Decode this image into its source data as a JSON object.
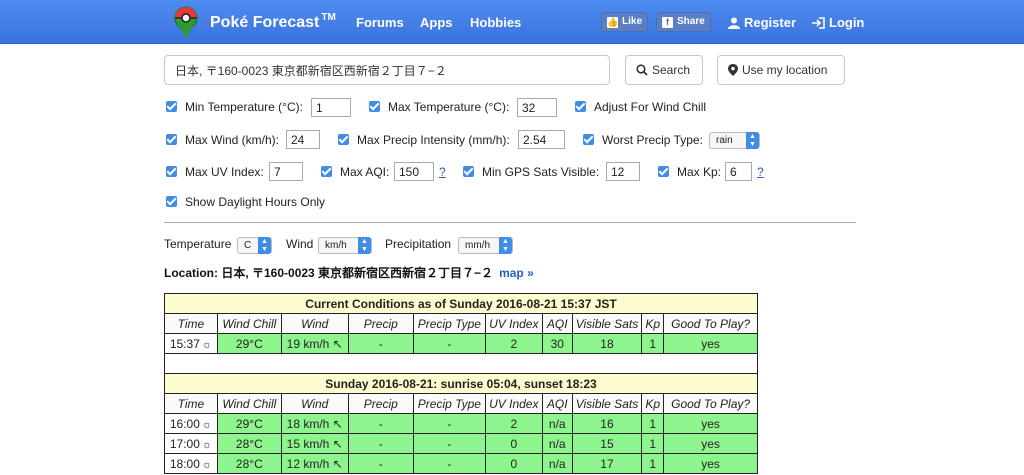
{
  "nav": {
    "brand": "Poké Forecast",
    "trademark": "TM",
    "links": [
      "Forums",
      "Apps",
      "Hobbies"
    ],
    "like": "Like",
    "share": "Share",
    "register": "Register",
    "login": "Login"
  },
  "search": {
    "value": "日本, 〒160-0023 東京都新宿区西新宿２丁目７−２",
    "search_button": "Search",
    "location_button": "Use my location"
  },
  "options": {
    "min_temp_label": "Min Temperature (°C):",
    "min_temp": "1",
    "max_temp_label": "Max Temperature (°C):",
    "max_temp": "32",
    "wind_chill_label": "Adjust For Wind Chill",
    "max_wind_label": "Max Wind (km/h):",
    "max_wind": "24",
    "max_precip_label": "Max Precip Intensity (mm/h):",
    "max_precip": "2.54",
    "worst_precip_label": "Worst Precip Type:",
    "worst_precip": "rain",
    "max_uv_label": "Max UV Index:",
    "max_uv": "7",
    "max_aqi_label": "Max AQI:",
    "max_aqi": "150",
    "min_gps_label": "Min GPS Sats Visible:",
    "min_gps": "12",
    "max_kp_label": "Max Kp:",
    "max_kp": "6",
    "help": "?",
    "daylight_label": "Show Daylight Hours Only"
  },
  "units": {
    "temperature_label": "Temperature",
    "temperature": "C",
    "wind_label": "Wind",
    "wind": "km/h",
    "precip_label": "Precipitation",
    "precip": "mm/h"
  },
  "location": {
    "text": "Location: 日本, 〒160-0023 東京都新宿区西新宿２丁目７−２",
    "map_link": "map »"
  },
  "table": {
    "current_caption": "Current Conditions as of Sunday 2016-08-21 15:37 JST",
    "headers": [
      "Time",
      "Wind Chill",
      "Wind",
      "Precip",
      "Precip Type",
      "UV Index",
      "AQI",
      "Visible Sats",
      "Kp",
      "Good To Play?"
    ],
    "current_row": [
      "15:37",
      "29°C",
      "19 km/h ↖",
      "-",
      "-",
      "2",
      "30",
      "18",
      "1",
      "yes"
    ],
    "day_caption": "Sunday 2016-08-21: sunrise 05:04, sunset 18:23",
    "day_rows": [
      [
        "16:00",
        "29°C",
        "18 km/h ↖",
        "-",
        "-",
        "2",
        "n/a",
        "16",
        "1",
        "yes"
      ],
      [
        "17:00",
        "28°C",
        "15 km/h ↖",
        "-",
        "-",
        "0",
        "n/a",
        "15",
        "1",
        "yes"
      ],
      [
        "18:00",
        "28°C",
        "12 km/h ↖",
        "-",
        "-",
        "0",
        "n/a",
        "17",
        "1",
        "yes"
      ]
    ],
    "sun_icon": "☼"
  }
}
